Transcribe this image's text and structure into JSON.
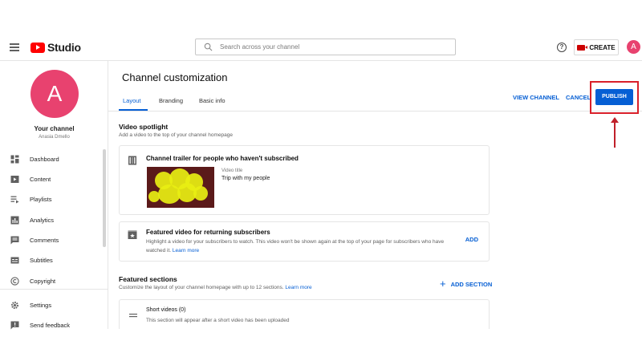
{
  "header": {
    "logo_text": "Studio",
    "search_placeholder": "Search across your channel",
    "help_glyph": "?",
    "create_label": "CREATE",
    "avatar_letter": "A",
    "icons": [
      "menu-icon",
      "youtube-logo-icon",
      "search-icon",
      "help-icon",
      "video-camera-icon"
    ]
  },
  "sidebar": {
    "avatar_letter": "A",
    "your_channel": "Your channel",
    "channel_name": "Anasia Dmello",
    "items": [
      {
        "label": "Dashboard",
        "icon": "dashboard-icon"
      },
      {
        "label": "Content",
        "icon": "content-icon"
      },
      {
        "label": "Playlists",
        "icon": "playlists-icon"
      },
      {
        "label": "Analytics",
        "icon": "analytics-icon"
      },
      {
        "label": "Comments",
        "icon": "comments-icon"
      },
      {
        "label": "Subtitles",
        "icon": "subtitles-icon"
      },
      {
        "label": "Copyright",
        "icon": "copyright-icon"
      },
      {
        "label": "Settings",
        "icon": "settings-icon"
      },
      {
        "label": "Send feedback",
        "icon": "feedback-icon"
      }
    ]
  },
  "main": {
    "title": "Channel customization",
    "tabs": [
      {
        "label": "Layout",
        "active": true
      },
      {
        "label": "Branding",
        "active": false
      },
      {
        "label": "Basic info",
        "active": false
      }
    ],
    "actions": {
      "view_channel": "VIEW CHANNEL",
      "cancel": "CANCEL",
      "publish": "PUBLISH"
    },
    "video_spotlight": {
      "title": "Video spotlight",
      "subtitle": "Add a video to the top of your channel homepage",
      "trailer_card": {
        "title": "Channel trailer for people who haven't subscribed",
        "video_title_label": "Video title",
        "video_title_value": "Trip with my people"
      },
      "featured_card": {
        "title": "Featured video for returning subscribers",
        "text_line1": "Highlight a video for your subscribers to watch. This video won't be shown again at the top of your page for subscribers who have",
        "text_line2": "watched it.",
        "learn_more": "Learn more",
        "add": "ADD"
      }
    },
    "featured_sections": {
      "title": "Featured sections",
      "subtitle": "Customize the layout of your channel homepage with up to 12 sections.",
      "learn_more": "Learn more",
      "add_section": "ADD SECTION",
      "short_videos_card": {
        "title": "Short videos (0)",
        "text": "This section will appear after a short video has been uploaded"
      }
    }
  },
  "colors": {
    "accent_blue": "#065fd4",
    "avatar_pink": "#e8426f",
    "annotation_red": "#d9202a",
    "youtube_red": "#ff0000"
  }
}
